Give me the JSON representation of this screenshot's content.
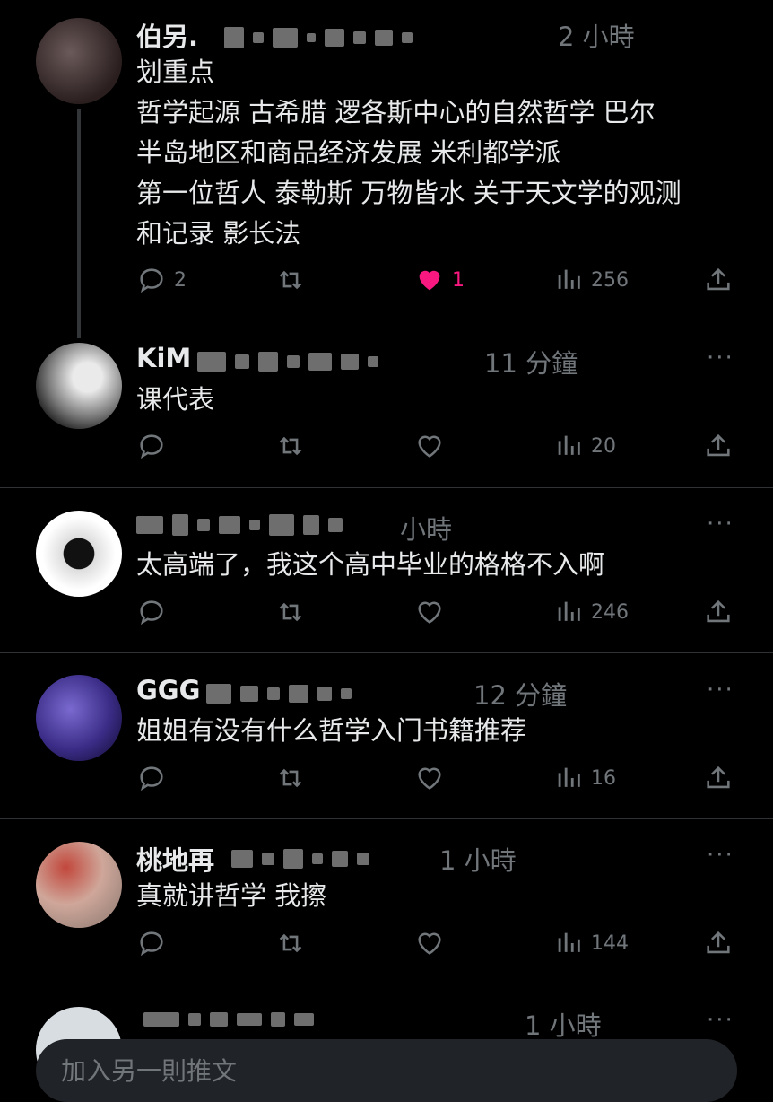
{
  "posts": [
    {
      "name": "伯另.",
      "time": "2 小時",
      "lines": [
        "划重点",
        "哲学起源 古希腊 逻各斯中心的自然哲学 巴尔",
        "半岛地区和商品经济发展 米利都学派",
        "第一位哲人 泰勒斯 万物皆水 关于天文学的观测",
        "和记录 影长法"
      ],
      "replies": "2",
      "retweets": "",
      "likes": "1",
      "views": "256",
      "liked": true
    },
    {
      "name": "KiM",
      "time": "11 分鐘",
      "lines": [
        "课代表"
      ],
      "replies": "",
      "retweets": "",
      "likes": "",
      "views": "20",
      "liked": false
    },
    {
      "name": "",
      "time": "小時",
      "lines": [
        "太高端了，我这个高中毕业的格格不入啊"
      ],
      "replies": "",
      "retweets": "",
      "likes": "",
      "views": "246",
      "liked": false
    },
    {
      "name": "GGG",
      "time": "12 分鐘",
      "lines": [
        "姐姐有没有什么哲学入门书籍推荐"
      ],
      "replies": "",
      "retweets": "",
      "likes": "",
      "views": "16",
      "liked": false
    },
    {
      "name": "桃地再",
      "time": "1 小時",
      "lines": [
        "真就讲哲学 我擦"
      ],
      "replies": "",
      "retweets": "",
      "likes": "",
      "views": "144",
      "liked": false
    },
    {
      "name": "",
      "time": "1 小時",
      "lines": [],
      "replies": "",
      "retweets": "",
      "likes": "",
      "views": "",
      "liked": false
    }
  ],
  "composer": {
    "placeholder": "加入另一則推文"
  },
  "more_label": "···",
  "icons": [
    "reply-icon",
    "retweet-icon",
    "like-icon",
    "views-icon",
    "share-icon",
    "more-icon"
  ],
  "colors": {
    "like_active": "#f91880",
    "muted": "#71767b",
    "text": "#e7e9ea",
    "background": "#000000"
  }
}
